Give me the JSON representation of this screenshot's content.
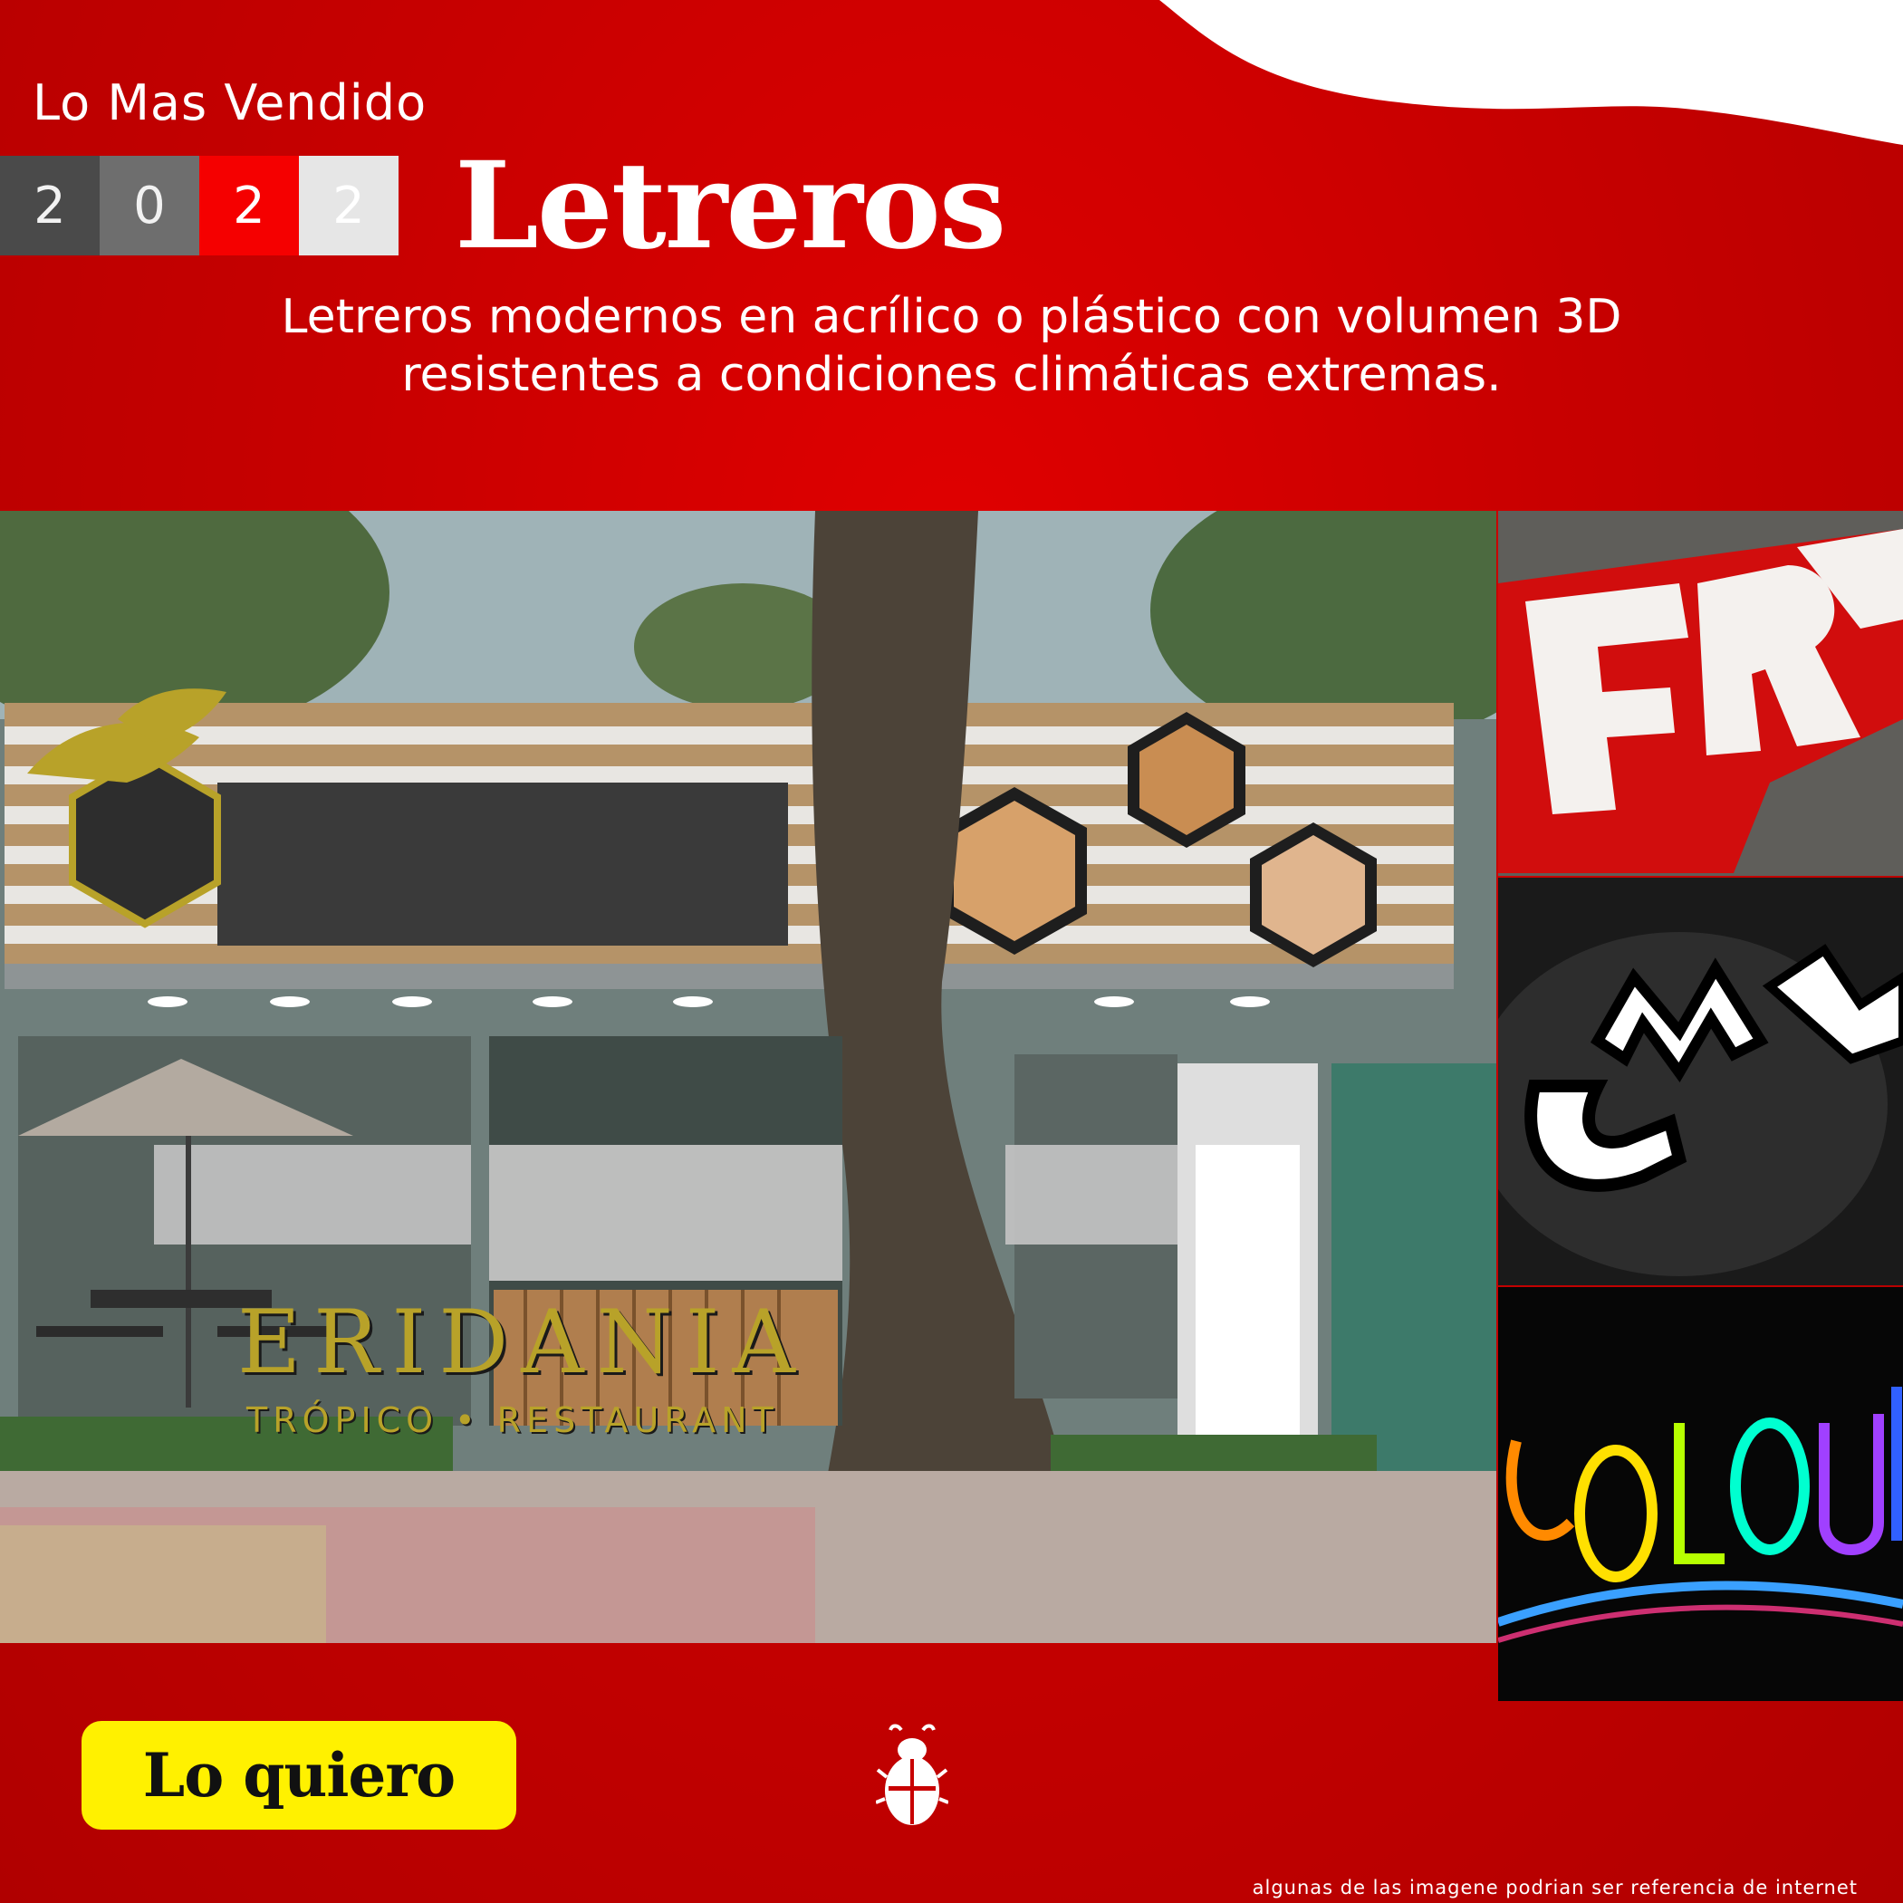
{
  "header": {
    "kicker": "Lo Mas Vendido",
    "year_digits": [
      "2",
      "0",
      "2",
      "2"
    ],
    "title": "Letreros",
    "subtitle_line1": "Letreros modernos en acrílico o plástico con volumen 3D",
    "subtitle_line2": "resistentes a condiciones climáticas extremas."
  },
  "photos": {
    "main": {
      "sign_name": "ERIDANIA",
      "sign_subtitle": "TRÓPICO • RESTAURANT"
    }
  },
  "cta": {
    "label": "Lo quiero"
  },
  "footer": {
    "disclaimer": "algunas de las imagene podrian ser referencia de internet"
  },
  "colors": {
    "background": "#c80000",
    "cta_background": "#fff100",
    "sign_gold": "#b8a229"
  },
  "icons": {
    "brand_logo": "beetle-icon"
  }
}
